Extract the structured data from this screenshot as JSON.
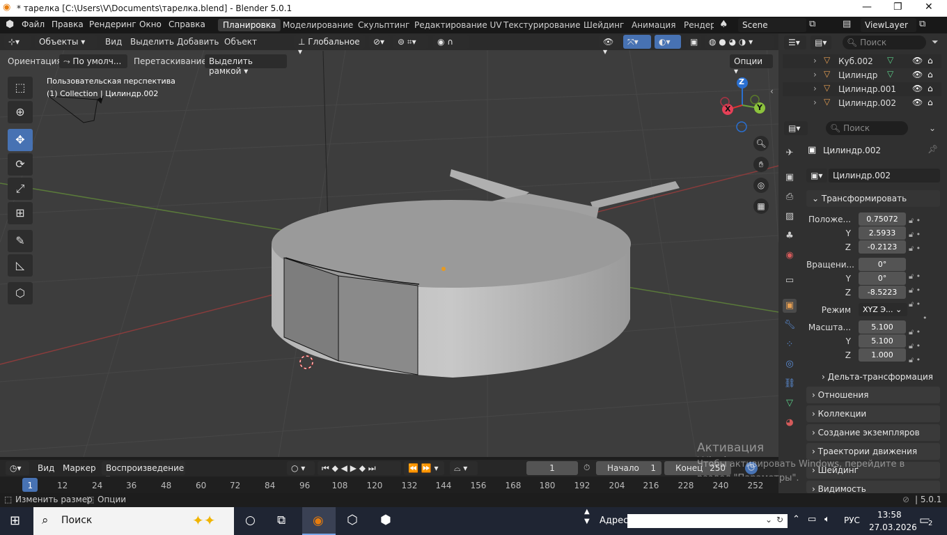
{
  "window": {
    "title": "* тарелка [C:\\Users\\V\\Documents\\тарелка.blend] - Blender 5.0.1"
  },
  "topbar": {
    "menus": [
      "Файл",
      "Правка",
      "Рендеринг",
      "Окно",
      "Справка"
    ],
    "workspaces": [
      "Планировка",
      "Моделирование",
      "Скульптинг",
      "Редактирование UV",
      "Текстурирование",
      "Шейдинг",
      "Анимация",
      "Рендер"
    ],
    "scene": "Scene",
    "view_layer": "ViewLayer"
  },
  "viewport_header": {
    "mode": "Объекты",
    "menus": [
      "Вид",
      "Выделить",
      "Добавить",
      "Объект"
    ],
    "transform_space": "Глобальное",
    "orientation_label": "Ориентация:",
    "orientation_value": "По умолч...",
    "drag_label": "Перетаскивание:",
    "drag_value": "Выделить рамкой",
    "options": "Опции"
  },
  "viewport": {
    "view_name": "Пользовательская перспектива",
    "collection_info": "(1) Collection | Цилиндр.002",
    "gizmo": {
      "x": "X",
      "y": "Y",
      "z": "Z"
    }
  },
  "outliner": {
    "search_placeholder": "Поиск",
    "items": [
      "Куб.002",
      "Цилиндр",
      "Цилиндр.001",
      "Цилиндр.002"
    ]
  },
  "properties": {
    "search_placeholder": "Поиск",
    "object_name": "Цилиндр.002",
    "object_data": "Цилиндр.002",
    "transform_header": "Трансформировать",
    "location_label": "Положе...",
    "location": [
      "0.75072",
      "2.5933",
      "-0.2123"
    ],
    "rotation_label": "Вращени...",
    "rotation": [
      "0°",
      "0°",
      "-8.5223"
    ],
    "mode_label": "Режим",
    "mode_value": "XYZ Э...",
    "scale_label": "Масшта...",
    "scale": [
      "5.100",
      "5.100",
      "1.000"
    ],
    "axis_labels": [
      "Y",
      "Z"
    ],
    "delta": "Дельта-трансформация",
    "sections": [
      "Отношения",
      "Коллекции",
      "Создание экземпляров",
      "Траектории движения",
      "Шейдинг",
      "Видимость"
    ]
  },
  "timeline": {
    "menus": [
      "Вид",
      "Маркер"
    ],
    "playback": "Воспроизведение",
    "current_frame": "1",
    "start_label": "Начало",
    "start": "1",
    "end_label": "Конец",
    "end": "250",
    "ruler": [
      "1",
      "12",
      "24",
      "36",
      "48",
      "60",
      "72",
      "84",
      "96",
      "108",
      "120",
      "132",
      "144",
      "156",
      "168",
      "180",
      "192",
      "204",
      "216",
      "228",
      "240",
      "252"
    ]
  },
  "statusbar": {
    "left1": "Изменить размер",
    "left2": "Опции",
    "version": "5.0.1"
  },
  "watermark": {
    "line1": "Активация Windows",
    "line2": "Чтобы активировать Windows, перейдите в",
    "line3": "раздел \"Параметры\"."
  },
  "taskbar": {
    "search": "Поиск",
    "address_label": "Адрес",
    "lang": "РУС",
    "time": "13:58",
    "date": "27.03.2026",
    "notifications": "2"
  },
  "colors": {
    "accent": "#4772b3",
    "background": "#3d3d3d",
    "panel": "#303030"
  }
}
